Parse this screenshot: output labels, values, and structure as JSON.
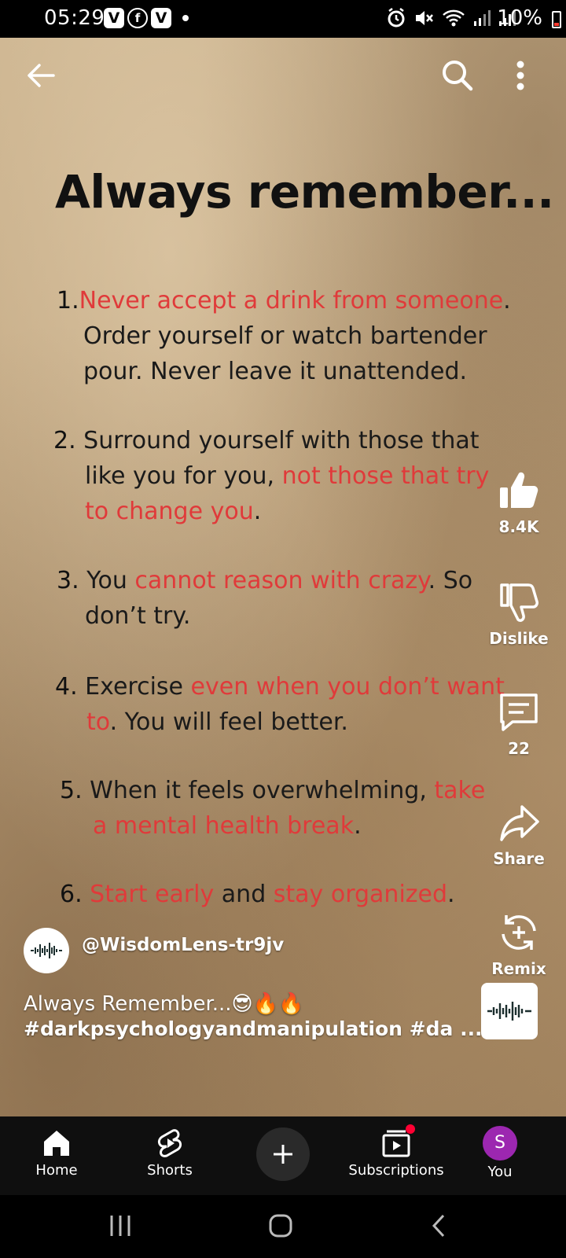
{
  "status_bar": {
    "time": "05:29",
    "app_badges": [
      "V",
      "f",
      "V"
    ],
    "battery": "10%",
    "icons": [
      "alarm-icon",
      "mute-icon",
      "wifi-icon",
      "signal-icon",
      "signal-icon"
    ]
  },
  "top_bar": {
    "back_icon": "back-arrow-icon",
    "search_icon": "search-icon",
    "more_icon": "more-vert-icon"
  },
  "post": {
    "title": "Always remember...",
    "items": [
      {
        "num": "1.",
        "parts": [
          {
            "text": "Never accept a drink from someone",
            "red": true
          },
          {
            "text": ".",
            "red": false
          }
        ],
        "lines_extra": [
          "Order yourself or watch bartender",
          "pour. Never leave it unattended."
        ]
      },
      {
        "num": "2.",
        "l1": "Surround yourself with those that",
        "l2a": "like you for you, ",
        "l2b": "not those that try",
        "l3a": "to change you",
        "l3b": "."
      },
      {
        "num": "3.",
        "l1a": "You ",
        "l1b": "cannot reason with crazy",
        "l1c": ". So",
        "l2": "don’t try."
      },
      {
        "num": "4.",
        "l1a": "Exercise ",
        "l1b": "even when you don’t want",
        "l2a": "to",
        "l2b": ". You will feel better."
      },
      {
        "num": "5.",
        "l1a": "When it feels overwhelming, ",
        "l1b": "take",
        "l2a": "a mental health break",
        "l2b": "."
      },
      {
        "num": "6.",
        "l1a": "Start early",
        "l1b": " and ",
        "l1c": "stay organized",
        "l1d": "."
      }
    ]
  },
  "actions": {
    "like_count": "8.4K",
    "dislike_label": "Dislike",
    "comment_count": "22",
    "share_label": "Share",
    "remix_label": "Remix"
  },
  "channel": {
    "handle": "@WisdomLens-tr9jv",
    "caption": "Always Remember...😎🔥🔥",
    "hashtags": "#darkpsychologyandmanipulation  #da ..."
  },
  "bottom_nav": {
    "home": "Home",
    "shorts": "Shorts",
    "subscriptions": "Subscriptions",
    "you": "You",
    "avatar_letter": "S"
  },
  "colors": {
    "accent_red": "#e03a3a",
    "brand_red": "#ff0033",
    "avatar_purple": "#9c27b0"
  }
}
